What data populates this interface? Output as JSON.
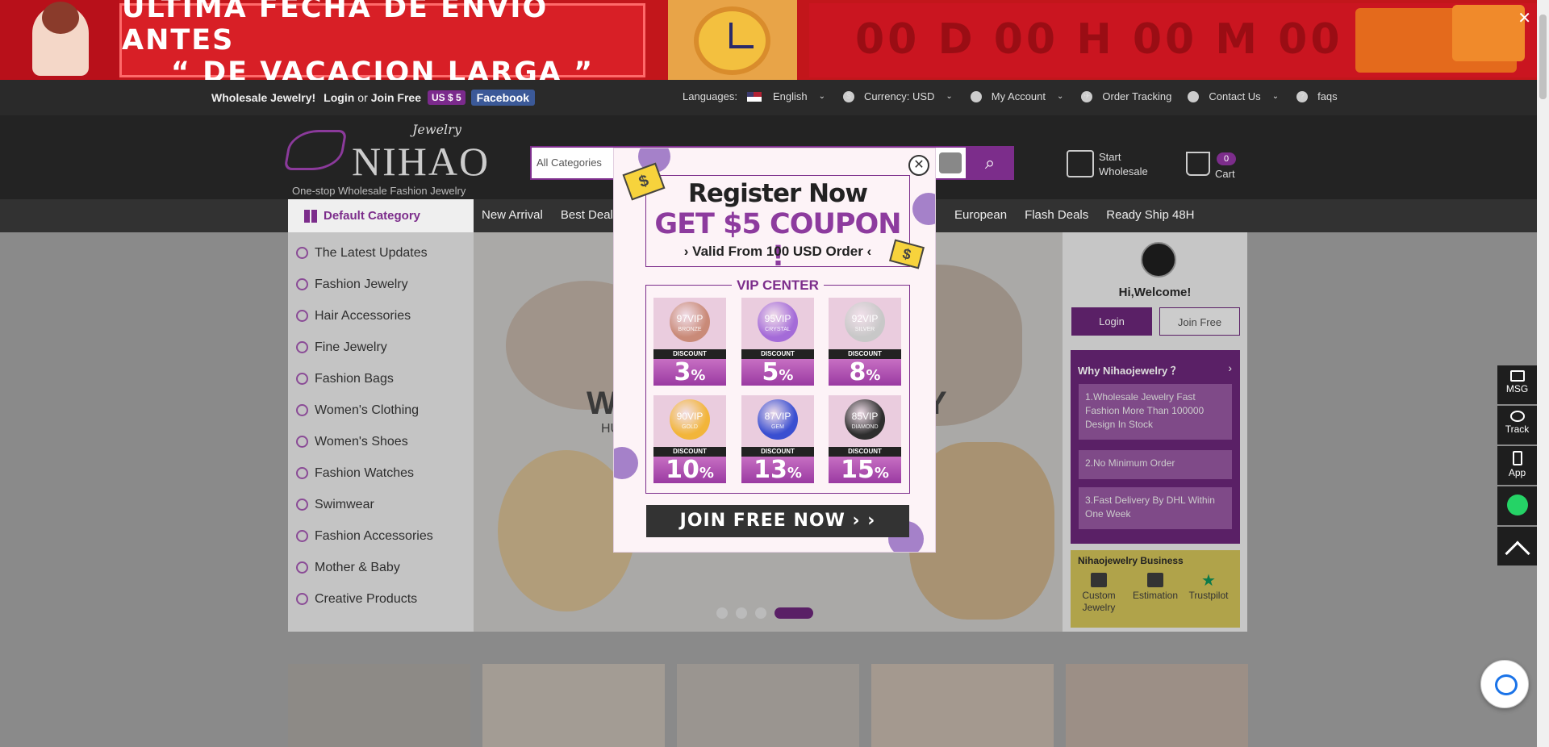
{
  "banner": {
    "line1": "ÚLTIMA FECHA DE ENVÍO ANTES",
    "line2": "“  DE VACACION LARGA  ”",
    "countdown": "00 D 00 H 00 M 00 S",
    "close": "✕"
  },
  "topbar": {
    "wholesale": "Wholesale Jewelry!",
    "login": "Login",
    "or": "or",
    "join": "Join Free",
    "coupon_badge": "US $ 5",
    "facebook": "Facebook",
    "languages_label": "Languages:",
    "language": "English",
    "currency": "Currency: USD",
    "account": "My Account",
    "order_tracking": "Order Tracking",
    "contact": "Contact Us",
    "faqs": "faqs"
  },
  "header": {
    "logo_top": "Jewelry",
    "logo_brand": "NIHAO",
    "logo_tagline": "One-stop Wholesale Fashion Jewelry",
    "search_category": "All Categories",
    "start_wholesale_1": "Start",
    "start_wholesale_2": "Wholesale",
    "cart_count": "0",
    "cart_label": "Cart"
  },
  "nav": {
    "default_category": "Default Category",
    "links_left": [
      "New Arrival",
      "Best Deal"
    ],
    "links_right": [
      "European",
      "Flash Deals",
      "Ready Ship 48H"
    ]
  },
  "sidebar": {
    "items": [
      "The Latest Updates",
      "Fashion Jewelry",
      "Hair Accessories",
      "Fine Jewelry",
      "Fashion Bags",
      "Women's Clothing",
      "Women's Shoes",
      "Fashion Watches",
      "Swimwear",
      "Fashion Accessories",
      "Mother & Baby",
      "Creative Products"
    ]
  },
  "hero": {
    "text_left": "W",
    "text_right": "Y",
    "subtext": "HU"
  },
  "account_panel": {
    "welcome": "Hi,Welcome!",
    "login": "Login",
    "join": "Join Free",
    "why_title": "Why Nihaojewelry ？",
    "why_items": [
      "1.Wholesale Jewelry Fast Fashion More Than 100000 Design In Stock",
      "2.No Minimum Order",
      "3.Fast Delivery By DHL Within One Week"
    ],
    "business_title": "Nihaojewelry Business",
    "business_items": [
      "Custom Jewelry",
      "Estimation",
      "Trustpilot"
    ]
  },
  "side_buttons": [
    "MSG",
    "Track",
    "App"
  ],
  "modal": {
    "close": "✕",
    "title": "Register Now",
    "coupon": "GET $5 COUPON !",
    "valid": "› Valid From 100 USD Order ‹",
    "vip_title": "VIP CENTER",
    "discount_label": "DISCOUNT",
    "tiers": [
      {
        "level": "97VIP",
        "name": "BRONZE",
        "pct": "3",
        "color": "#c98a78"
      },
      {
        "level": "95VIP",
        "name": "CRYSTAL",
        "pct": "5",
        "color": "#a46bd8"
      },
      {
        "level": "92VIP",
        "name": "SILVER",
        "pct": "8",
        "color": "#c8c8c8"
      },
      {
        "level": "90VIP",
        "name": "GOLD",
        "pct": "10",
        "color": "#f2b53a"
      },
      {
        "level": "87VIP",
        "name": "GEM",
        "pct": "13",
        "color": "#3a4fd1"
      },
      {
        "level": "85VIP",
        "name": "DIAMOND",
        "pct": "15",
        "color": "#2e2e2e"
      }
    ],
    "join_button": "JOIN  FREE  NOW  › ›"
  },
  "product_colors": [
    "#8d8a86",
    "#a39c94",
    "#9a9590",
    "#a4998f",
    "#9c8f86"
  ]
}
